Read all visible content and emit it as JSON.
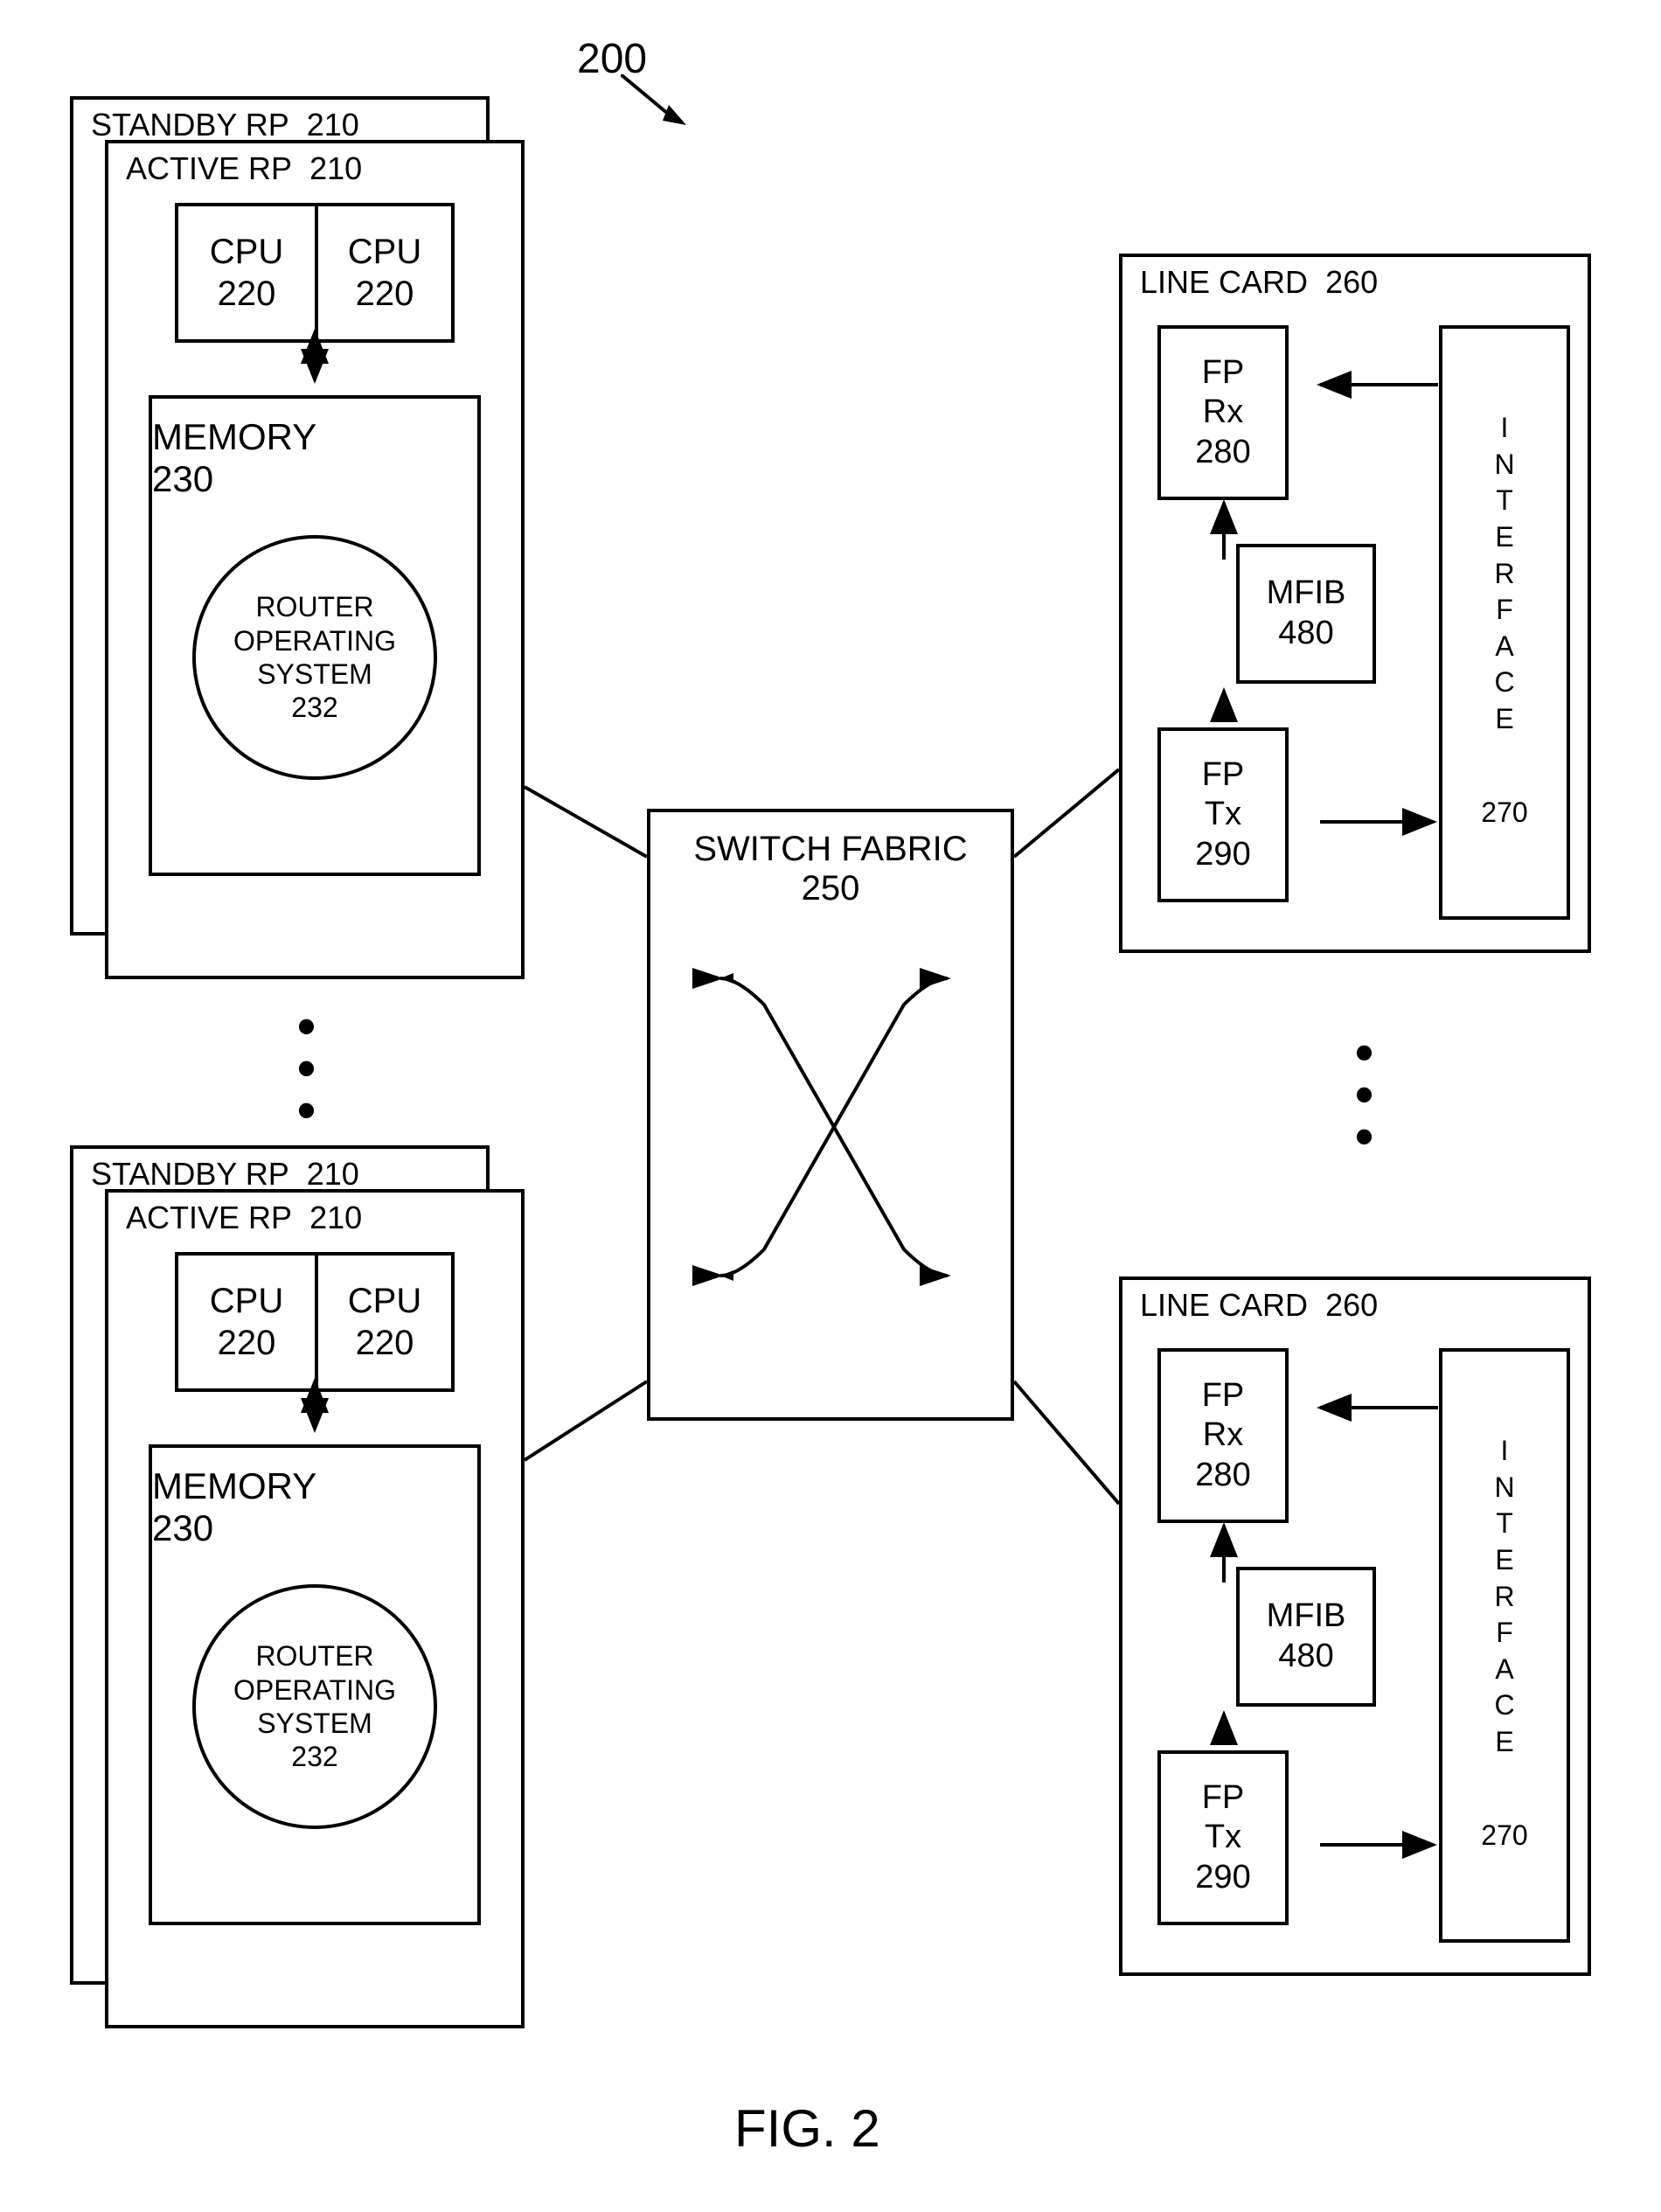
{
  "figure_number": "200",
  "figure_label": "FIG. 2",
  "standby_rp": {
    "label": "STANDBY RP",
    "id": "210"
  },
  "active_rp": {
    "label": "ACTIVE RP",
    "id": "210"
  },
  "cpu": {
    "label": "CPU",
    "id": "220"
  },
  "memory": {
    "label": "MEMORY",
    "id": "230"
  },
  "router_os": {
    "line1": "ROUTER",
    "line2": "OPERATING",
    "line3": "SYSTEM",
    "id": "232"
  },
  "switch_fabric": {
    "label": "SWITCH FABRIC",
    "id": "250"
  },
  "line_card": {
    "label": "LINE CARD",
    "id": "260"
  },
  "interface": {
    "label": "INTERFACE",
    "id": "270"
  },
  "fp_rx": {
    "line1": "FP",
    "line2": "Rx",
    "id": "280"
  },
  "fp_tx": {
    "line1": "FP",
    "line2": "Tx",
    "id": "290"
  },
  "mfib": {
    "label": "MFIB",
    "id": "480"
  }
}
